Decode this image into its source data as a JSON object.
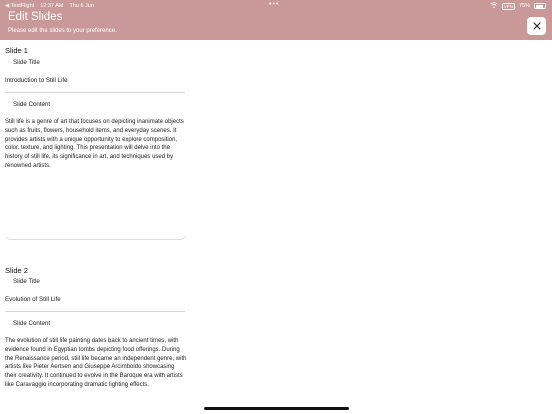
{
  "status_bar": {
    "back_app": "◀ TestFlight",
    "time": "12:37 AM",
    "date": "Thu 6 Jun",
    "dots": "•••",
    "vpn": "VPN",
    "battery": "75%",
    "battery_level": 0.75
  },
  "header": {
    "title": "Edit Slides",
    "subtitle": "Please edit the slides to your preference.",
    "close_icon": "close-icon"
  },
  "slides": [
    {
      "heading": "Slide 1",
      "title_label": "Slide Title",
      "title_value": "Introduction to Still Life",
      "content_label": "Slide Content",
      "content_value": "Still life is a genre of art that focuses on depicting inanimate objects such as fruits, flowers, household items, and everyday scenes. It provides artists with a unique opportunity to explore composition, color, texture, and lighting. This presentation will delve into the history of still life, its significance in art, and techniques used by renowned artists."
    },
    {
      "heading": "Slide 2",
      "title_label": "Slide Title",
      "title_value": "Evolution of Still Life",
      "content_label": "Slide Content",
      "content_value": "The evolution of still life painting dates back to ancient times, with evidence found in Egyptian tombs depicting food offerings. During the Renaissance period, still life became an independent genre, with artists like Pieter Aertsen and Giuseppe Arcimboldo showcasing their creativity. It continued to evolve in the Baroque era with artists like Caravaggio incorporating dramatic lighting effects."
    }
  ]
}
